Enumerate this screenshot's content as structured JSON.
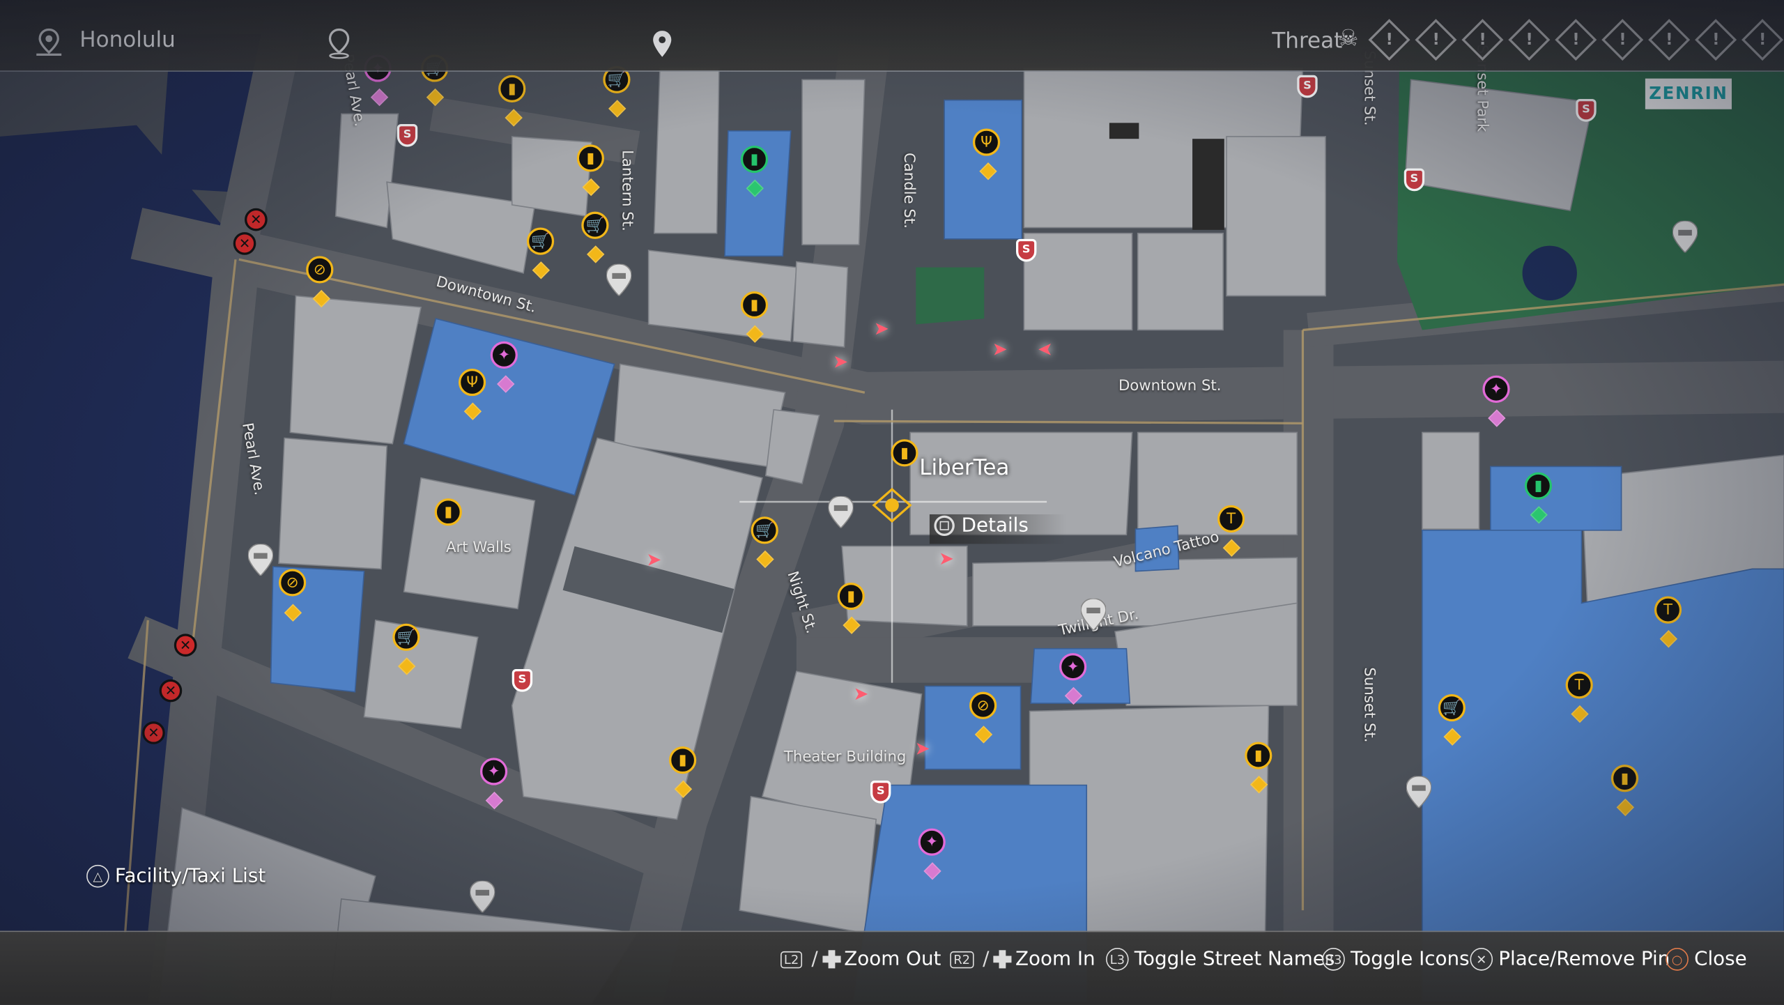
{
  "location": {
    "name": "Honolulu"
  },
  "threat": {
    "label": "Threat",
    "levels": 10,
    "active": 0
  },
  "map_provider": "ZENRIN",
  "selected": {
    "name": "LiberTea",
    "details_label": "Details"
  },
  "streets": [
    "Pearl Ave.",
    "Lantern St.",
    "Candle St.",
    "Sunset St.",
    "Sunset Park",
    "Downtown St.",
    "Downtown St.",
    "Pearl Ave.",
    "Art Walls",
    "Night St.",
    "Volcano Tattoo",
    "Twilight Dr.",
    "Sunset St.",
    "Theater Building"
  ],
  "facility": {
    "label": "Facility/Taxi List"
  },
  "controls": [
    {
      "button": "L2",
      "label": "Zoom Out"
    },
    {
      "button": "R2",
      "label": "Zoom In"
    },
    {
      "button": "L3",
      "label": "Toggle Street Names"
    },
    {
      "button": "R3",
      "label": "Toggle Icons"
    },
    {
      "button": "✕",
      "label": "Place/Remove Pin"
    },
    {
      "button": "○",
      "label": "Close"
    }
  ],
  "colors": {
    "road": "#5c5f65",
    "building": "#a6a8ac",
    "water": "#1e2c57",
    "facility": "#4f80c4",
    "park": "#2e6a48",
    "accent": "#f2b719",
    "minigame": "#e26bd8",
    "security": "#c63b42"
  },
  "icons": [
    "location-pin-icon",
    "threat-skull-icon",
    "drink-icon",
    "shop-cart-icon",
    "restaurant-icon",
    "minigame-controller-icon",
    "taxi-icon",
    "security-shield-icon",
    "clothing-icon",
    "closed-x-icon"
  ]
}
